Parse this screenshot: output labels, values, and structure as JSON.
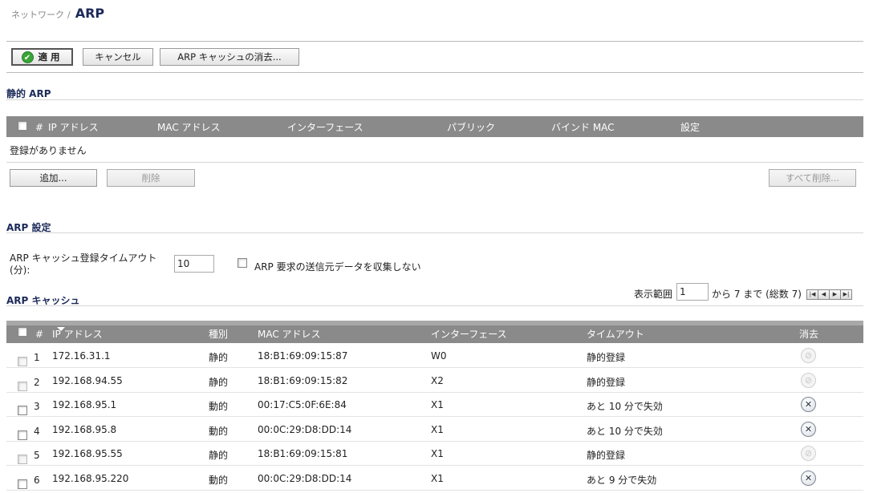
{
  "breadcrumb": {
    "parent": "ネットワーク",
    "separator": "/",
    "title": "ARP"
  },
  "toolbar": {
    "apply": "適用",
    "cancel": "キャンセル",
    "flush": "ARP キャッシュの消去..."
  },
  "static_arp": {
    "title": "静的 ARP",
    "columns": {
      "num": "#",
      "ip": "IP アドレス",
      "mac": "MAC アドレス",
      "iface": "インターフェース",
      "public": "パブリック",
      "bind": "バインド MAC",
      "config": "設定"
    },
    "empty": "登録がありません",
    "add": "追加...",
    "delete": "削除",
    "delete_all": "すべて削除..."
  },
  "arp_settings": {
    "title": "ARP 設定",
    "timeout_label_1": "ARP キャッシュ登録タイムアウト",
    "timeout_label_2": "(分):",
    "timeout_value": "10",
    "no_collect_label": "ARP 要求の送信元データを収集しない",
    "no_collect_checked": false
  },
  "arp_cache": {
    "title": "ARP キャッシュ",
    "range_label": "表示範囲",
    "range_value": "1",
    "range_suffix": "から 7 まで (総数 7)",
    "columns": {
      "num": "#",
      "ip": "IP アドレス",
      "type": "種別",
      "mac": "MAC アドレス",
      "iface": "インターフェース",
      "timeout": "タイムアウト",
      "delete": "消去"
    },
    "rows": [
      {
        "num": "1",
        "ip": "172.16.31.1",
        "type": "静的",
        "mac": "18:B1:69:09:15:87",
        "iface": "W0",
        "timeout": "静的登録",
        "deletable": false
      },
      {
        "num": "2",
        "ip": "192.168.94.55",
        "type": "静的",
        "mac": "18:B1:69:09:15:82",
        "iface": "X2",
        "timeout": "静的登録",
        "deletable": false
      },
      {
        "num": "3",
        "ip": "192.168.95.1",
        "type": "動的",
        "mac": "00:17:C5:0F:6E:84",
        "iface": "X1",
        "timeout": "あと 10 分で失効",
        "deletable": true
      },
      {
        "num": "4",
        "ip": "192.168.95.8",
        "type": "動的",
        "mac": "00:0C:29:D8:DD:14",
        "iface": "X1",
        "timeout": "あと 10 分で失効",
        "deletable": true
      },
      {
        "num": "5",
        "ip": "192.168.95.55",
        "type": "静的",
        "mac": "18:B1:69:09:15:81",
        "iface": "X1",
        "timeout": "静的登録",
        "deletable": false
      },
      {
        "num": "6",
        "ip": "192.168.95.220",
        "type": "動的",
        "mac": "00:0C:29:D8:DD:14",
        "iface": "X1",
        "timeout": "あと 9 分で失効",
        "deletable": true
      }
    ]
  },
  "icons": {
    "apply": "check-icon",
    "delete_row": "close-icon",
    "disabled_row": "disabled-icon"
  },
  "colors": {
    "header_bg": "#8a8a8a",
    "title": "#1c2a5a",
    "apply_green": "#3aa535"
  }
}
